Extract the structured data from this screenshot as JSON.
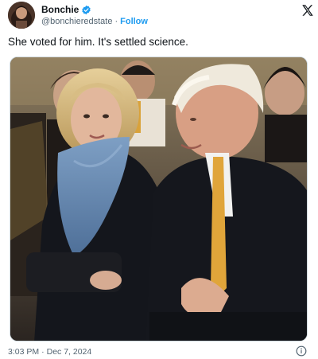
{
  "author": {
    "display_name": "Bonchie",
    "handle": "@bonchieredstate",
    "follow_label": "Follow",
    "separator": "·",
    "verified_icon": "verified-badge-icon",
    "avatar_icon": "avatar"
  },
  "brand": {
    "logo_icon": "x-logo-icon"
  },
  "tweet": {
    "text": "She voted for him. It's settled science.",
    "media_icon": "photo"
  },
  "meta": {
    "time": "3:03 PM",
    "separator": "·",
    "date": "Dec 7, 2024",
    "info_icon": "info-icon"
  },
  "colors": {
    "accent": "#1d9bf0",
    "text": "#0f1419",
    "muted": "#536471",
    "background": "#ffffff"
  }
}
